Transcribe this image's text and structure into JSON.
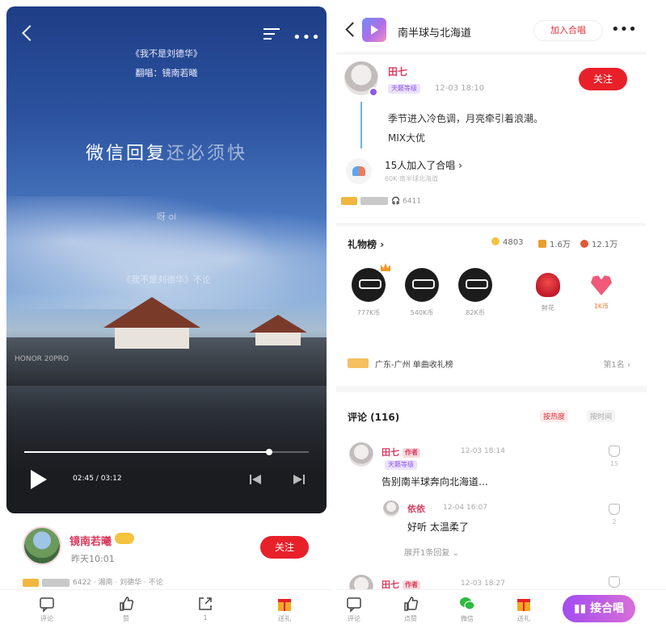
{
  "player": {
    "song_title": "《我不是刘德华》",
    "singer": "翻唱：镜南若曦",
    "lyric_main": "微信回复",
    "lyric_main_dim": "还必须快",
    "lyric_sub1": "呀 oi",
    "lyric_sub2": "《我不是刘德华》不论",
    "watermark": "HONOR 20PRO",
    "time": "02:45 / 03:12",
    "progress": 0.86
  },
  "left_profile": {
    "name": "镜南若曦",
    "time": "昨天10:01",
    "follow": "关注",
    "meta": "6422 · 湘南 · 刘德华 · 不论"
  },
  "left_bottom": {
    "comment": "评论",
    "like": "赞",
    "share": "1",
    "gift": "送礼"
  },
  "right_header": {
    "title": "南半球与北海道",
    "join": "加入合唱"
  },
  "post": {
    "name": "田七",
    "tag": "天籁等级",
    "date": "12-03 18:10",
    "follow": "关注",
    "desc1": "季节进入冷色调，月亮牵引着浪潮。",
    "desc2": "MIX大优",
    "joined": "15人加入了合唱",
    "joined_sub": "60K·南半球北海道",
    "plays": "6411"
  },
  "gifts": {
    "title": "礼物榜",
    "coins": "4803",
    "flowers": "1.6万",
    "kbi": "12.1万",
    "items": [
      {
        "label": "777K币"
      },
      {
        "label": "540K币"
      },
      {
        "label": "82K币"
      },
      {
        "label": "鲜花"
      },
      {
        "label": "1K币"
      }
    ],
    "rank_text": "广东-广州 单曲收礼榜",
    "rank_right": "第1名"
  },
  "comments": {
    "title": "评论 (116)",
    "sort_hot": "按热度",
    "sort_new": "按时间",
    "c1_name": "田七",
    "c1_pill": "作者",
    "c1_date": "12-03 18:14",
    "c1_tag": "天籁等级",
    "c1_text": "告别南半球奔向北海道…",
    "c1_likes": "15",
    "r1_name": "依依",
    "r1_date": "12-04 16:07",
    "r1_text": "好听  太温柔了",
    "r1_likes": "2",
    "expand": "展开1条回复",
    "c2_name": "田七",
    "c2_pill": "作者",
    "c2_date": "12-03 18:27"
  },
  "right_bottom": {
    "comment": "评论",
    "like": "点赞",
    "wechat": "微信",
    "gift": "送礼",
    "chorus": "接合唱"
  }
}
